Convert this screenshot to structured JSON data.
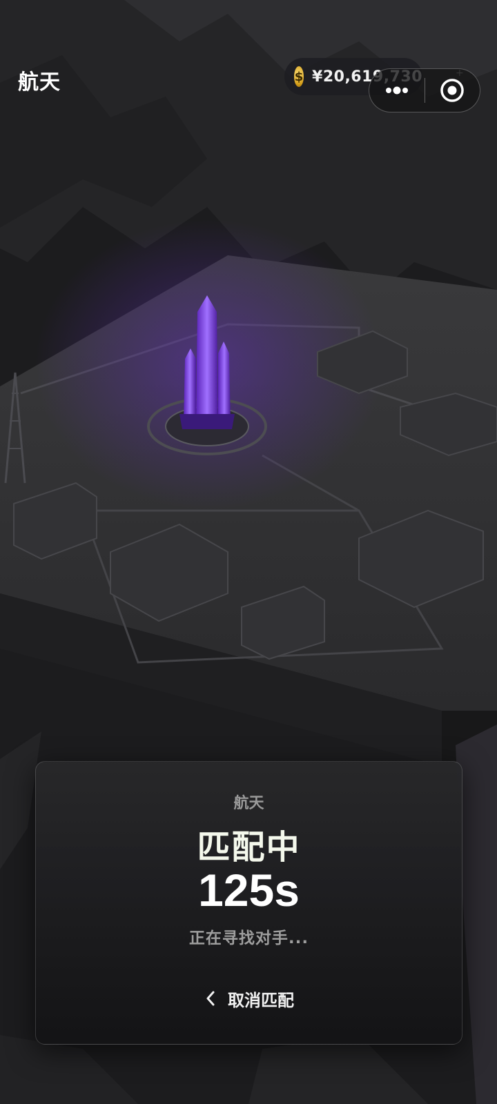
{
  "header": {
    "title": "航天",
    "balance": "¥20,619,730",
    "coin_icon": "coin-icon",
    "coin_symbol": "$",
    "plus_label": "+"
  },
  "capsule": {
    "menu_icon": "more-dots-icon",
    "close_icon": "record-target-icon"
  },
  "scene": {
    "description_icon": "rocket-launch-base-illustration",
    "accent_color": "#7b3fe4"
  },
  "match_panel": {
    "label": "航天",
    "status": "匹配中",
    "timer": "125s",
    "subtitle": "正在寻找对手...",
    "cancel_label": "取消匹配"
  }
}
